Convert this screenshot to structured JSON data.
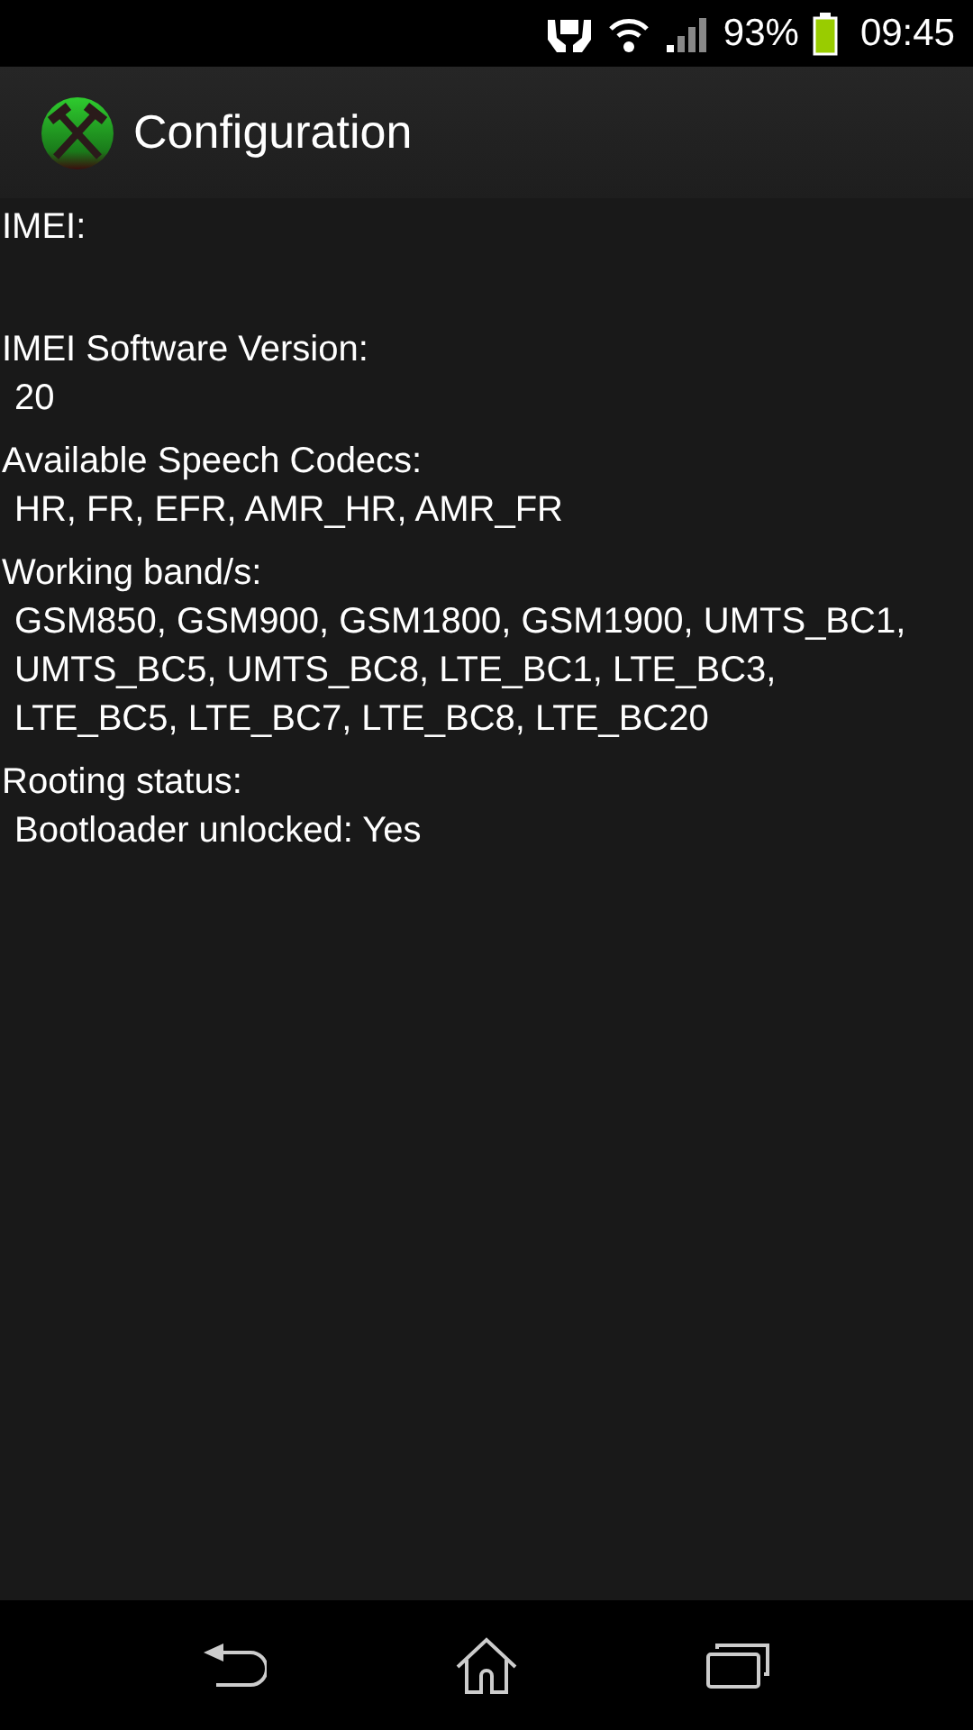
{
  "status_bar": {
    "battery": "93%",
    "time": "09:45"
  },
  "action_bar": {
    "title": "Configuration"
  },
  "sections": [
    {
      "label": "IMEI:"
    },
    {
      "label": "IMEI Software Version:",
      "value": "20"
    },
    {
      "label": "Available Speech Codecs:",
      "value": "HR, FR, EFR, AMR_HR, AMR_FR"
    },
    {
      "label": "Working band/s:",
      "value": "GSM850, GSM900, GSM1800, GSM1900, UMTS_BC1, UMTS_BC5, UMTS_BC8, LTE_BC1, LTE_BC3, LTE_BC5, LTE_BC7, LTE_BC8, LTE_BC20"
    },
    {
      "label": "Rooting status:",
      "value": "Bootloader unlocked: Yes"
    }
  ]
}
